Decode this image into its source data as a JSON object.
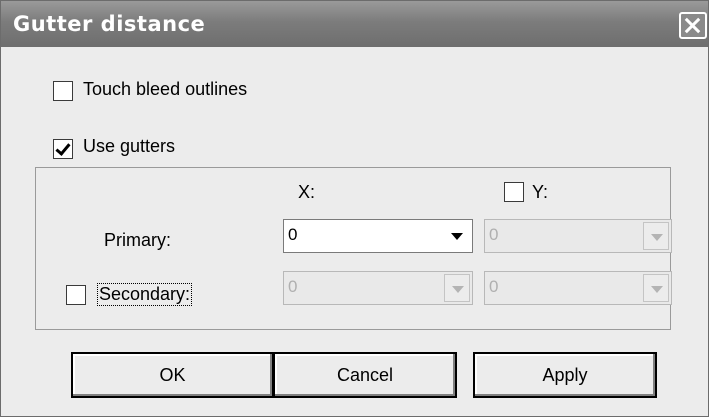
{
  "dialog": {
    "title": "Gutter distance",
    "close_icon": "close-icon"
  },
  "options": {
    "touch_bleed": {
      "label": "Touch bleed outlines",
      "checked": false
    },
    "use_gutters": {
      "label": "Use gutters",
      "checked": true
    }
  },
  "gutters": {
    "x_label": "X:",
    "y_label": "Y:",
    "y_checked": false,
    "primary": {
      "label": "Primary:",
      "x_value": "0",
      "y_value": "0"
    },
    "secondary": {
      "label": "Secondary:",
      "checked": false,
      "x_value": "0",
      "y_value": "0"
    }
  },
  "buttons": {
    "ok": "OK",
    "cancel": "Cancel",
    "apply": "Apply"
  }
}
